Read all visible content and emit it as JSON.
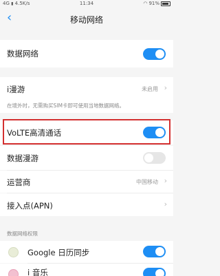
{
  "status_bar": {
    "network": "4G",
    "speed": "4.5K/s",
    "time": "11:34",
    "battery": "91%"
  },
  "header": {
    "title": "移动网络",
    "back_icon": "chevron-left-icon"
  },
  "items": {
    "mobile_data": {
      "label": "数据网络",
      "enabled": true
    },
    "i_roaming": {
      "label": "i漫游",
      "value": "未启用"
    },
    "roaming_note": "在境外时，无需购买SIM卡即可使用当地数据网络。",
    "volte": {
      "label": "VoLTE高清通话",
      "enabled": true
    },
    "data_roaming": {
      "label": "数据漫游",
      "enabled": false
    },
    "carrier": {
      "label": "运营商",
      "value": "中国移动"
    },
    "apn": {
      "label": "接入点(APN)"
    }
  },
  "permissions": {
    "section_title": "数据网络权限",
    "apps": [
      {
        "label": "Google 日历同步",
        "enabled": true
      },
      {
        "label": "i 音乐",
        "enabled": true
      }
    ]
  },
  "colors": {
    "accent": "#1e8ef4",
    "highlight": "#d32f2f"
  }
}
